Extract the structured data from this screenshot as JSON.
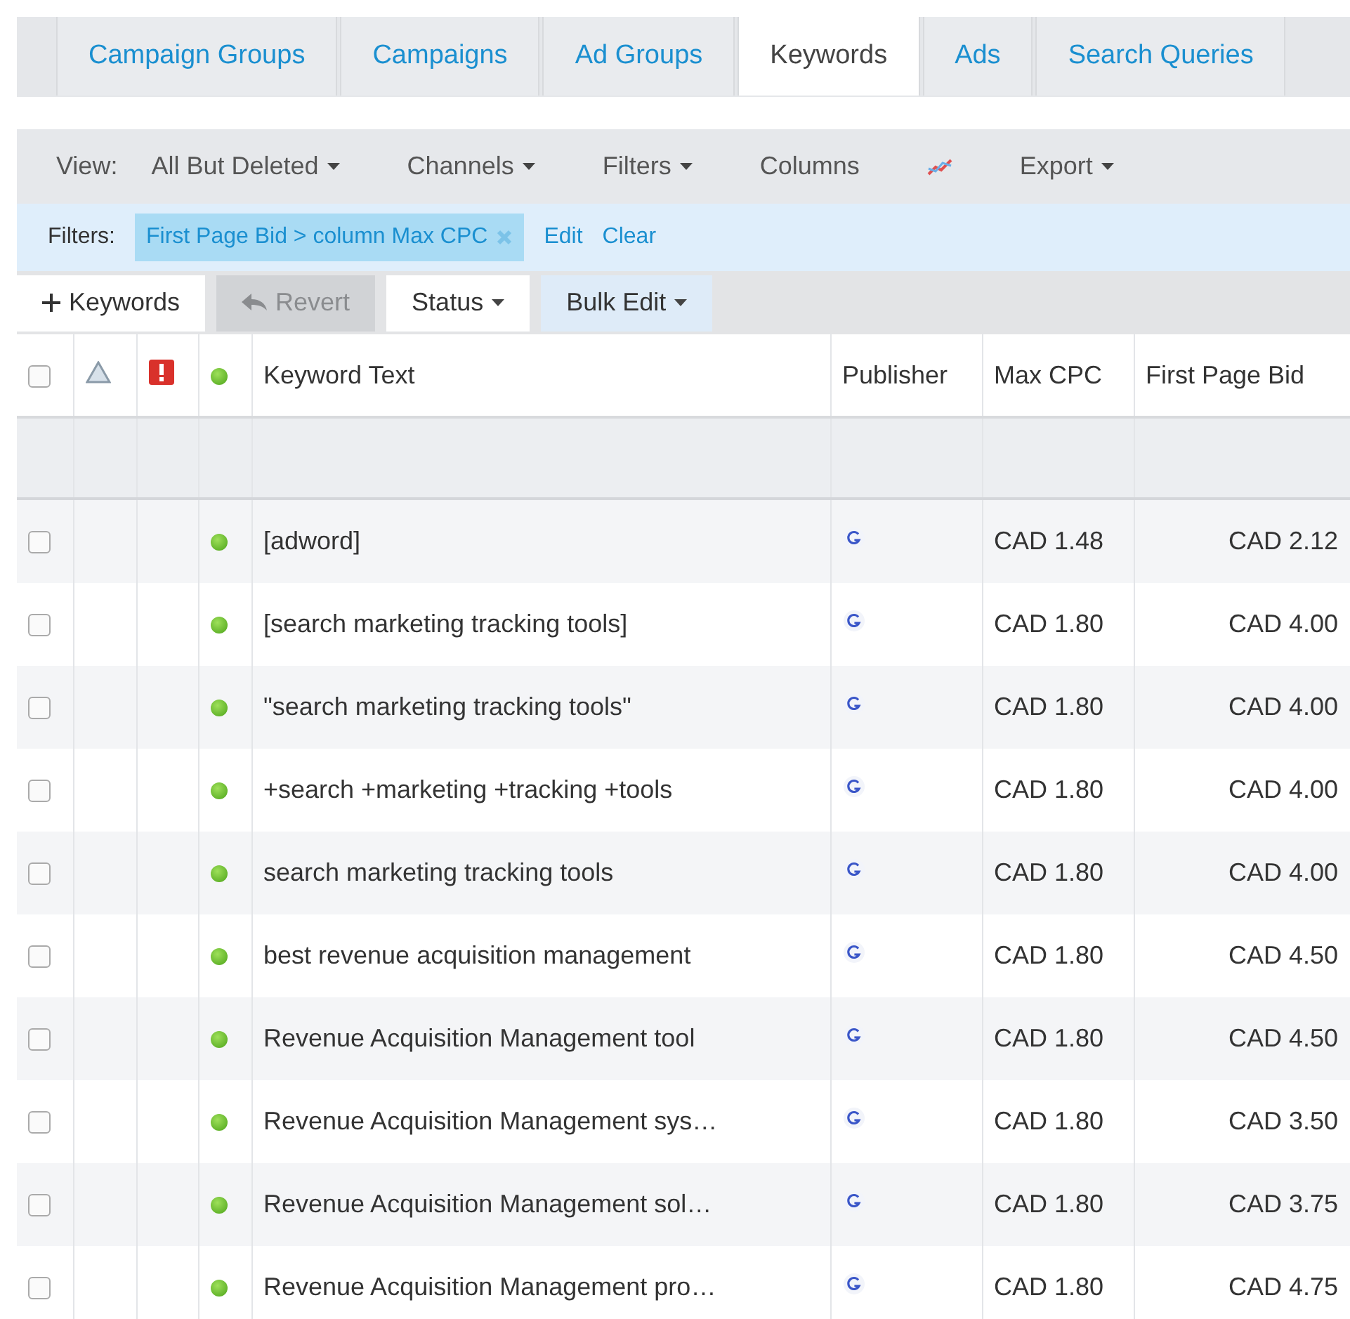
{
  "tabs": [
    {
      "label": "Campaign Groups",
      "selected": false
    },
    {
      "label": "Campaigns",
      "selected": false
    },
    {
      "label": "Ad Groups",
      "selected": false
    },
    {
      "label": "Keywords",
      "selected": true
    },
    {
      "label": "Ads",
      "selected": false
    },
    {
      "label": "Search Queries",
      "selected": false
    }
  ],
  "toolbar": {
    "view_label": "View:",
    "items": [
      {
        "kind": "menu",
        "label": "All But Deleted"
      },
      {
        "kind": "menu",
        "label": "Channels"
      },
      {
        "kind": "menu",
        "label": "Filters"
      },
      {
        "kind": "text",
        "label": "Columns"
      },
      {
        "kind": "chart"
      },
      {
        "kind": "menu",
        "label": "Export"
      }
    ]
  },
  "filter_bar": {
    "label": "Filters:",
    "chip": "First Page Bid > column Max CPC",
    "links": [
      "Edit",
      "Clear"
    ]
  },
  "actions": [
    {
      "kind": "add",
      "label": "Keywords"
    },
    {
      "kind": "revert",
      "label": "Revert",
      "disabled": true
    },
    {
      "kind": "menu",
      "label": "Status"
    },
    {
      "kind": "bulk",
      "label": "Bulk Edit"
    }
  ],
  "table": {
    "select_all_checked": false,
    "columns": [
      "Keyword Text",
      "Publisher",
      "Max CPC",
      "First Page Bid"
    ],
    "rows": [
      {
        "checked": false,
        "keyword": "[adword]",
        "max_cpc": "CAD 1.48",
        "first_page_bid": "CAD 2.12"
      },
      {
        "checked": false,
        "keyword": "[search marketing tracking tools]",
        "max_cpc": "CAD 1.80",
        "first_page_bid": "CAD 4.00"
      },
      {
        "checked": false,
        "keyword": "\"search marketing tracking tools\"",
        "max_cpc": "CAD 1.80",
        "first_page_bid": "CAD 4.00"
      },
      {
        "checked": false,
        "keyword": "+search +marketing +tracking +tools",
        "max_cpc": "CAD 1.80",
        "first_page_bid": "CAD 4.00"
      },
      {
        "checked": false,
        "keyword": "search marketing tracking tools",
        "max_cpc": "CAD 1.80",
        "first_page_bid": "CAD 4.00"
      },
      {
        "checked": false,
        "keyword": "best revenue acquisition management",
        "max_cpc": "CAD 1.80",
        "first_page_bid": "CAD 4.50"
      },
      {
        "checked": false,
        "keyword": "Revenue Acquisition Management tool",
        "max_cpc": "CAD 1.80",
        "first_page_bid": "CAD 4.50"
      },
      {
        "checked": false,
        "keyword": "Revenue Acquisition Management sys…",
        "max_cpc": "CAD 1.80",
        "first_page_bid": "CAD 3.50"
      },
      {
        "checked": false,
        "keyword": "Revenue Acquisition Management sol…",
        "max_cpc": "CAD 1.80",
        "first_page_bid": "CAD 3.75"
      },
      {
        "checked": false,
        "keyword": "Revenue Acquisition Management pro…",
        "max_cpc": "CAD 1.80",
        "first_page_bid": "CAD 4.75"
      }
    ]
  }
}
